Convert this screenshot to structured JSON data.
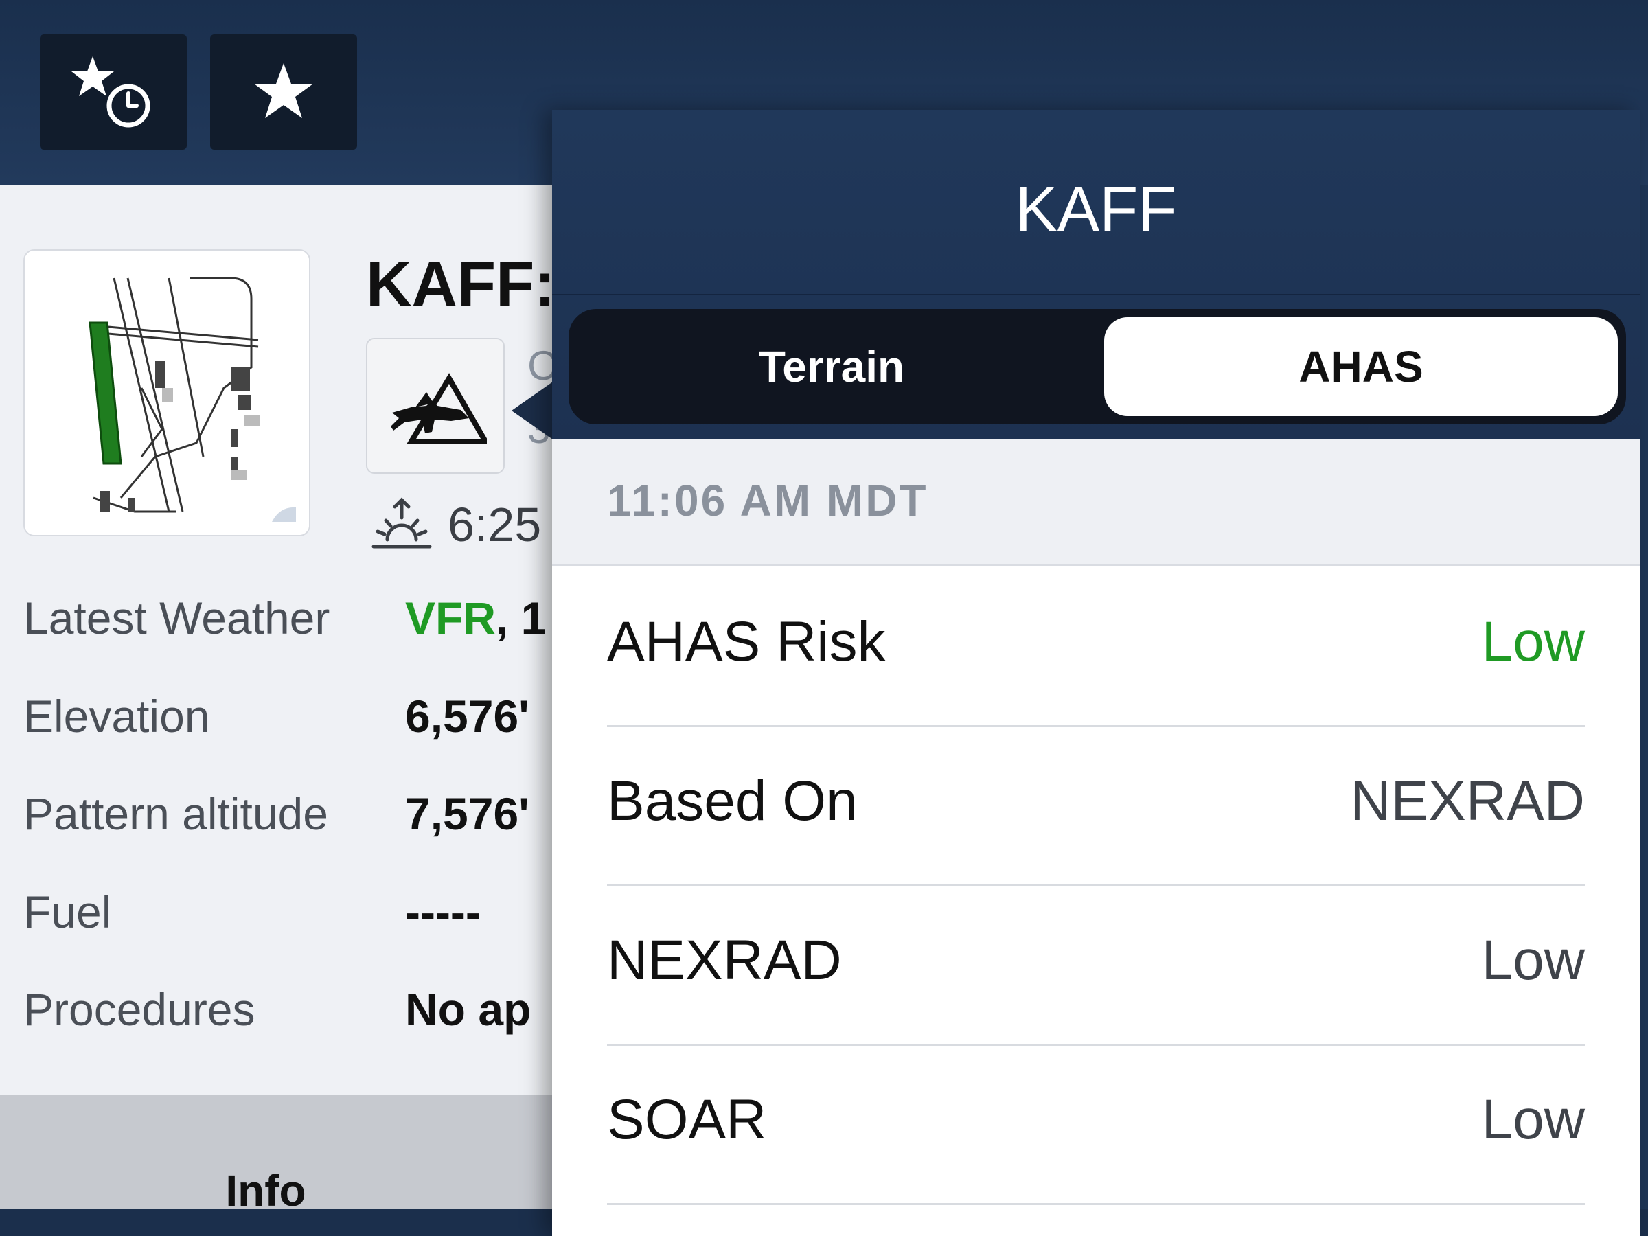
{
  "top_bar": {
    "recent_favorites_label": "Recent favorites",
    "favorites_label": "Favorites"
  },
  "airport": {
    "title": "KAFF:",
    "cut_line1": "C",
    "cut_line2": "3",
    "sunrise_time": "6:25",
    "info_rows": [
      {
        "label": "Latest Weather",
        "value_status": "VFR",
        "value_rest": ", 1"
      },
      {
        "label": "Elevation",
        "value": "6,576'"
      },
      {
        "label": "Pattern altitude",
        "value": "7,576'"
      },
      {
        "label": "Fuel",
        "value": "-----"
      },
      {
        "label": "Procedures",
        "value": "No ap"
      }
    ],
    "tab_info": "Info"
  },
  "popover": {
    "title": "KAFF",
    "segments": [
      {
        "label": "Terrain",
        "selected": false
      },
      {
        "label": "AHAS",
        "selected": true
      }
    ],
    "timestamp": "11:06 AM MDT",
    "rows": [
      {
        "label": "AHAS Risk",
        "value": "Low",
        "highlight": true
      },
      {
        "label": "Based On",
        "value": "NEXRAD",
        "highlight": false
      },
      {
        "label": "NEXRAD",
        "value": "Low",
        "highlight": false
      },
      {
        "label": "SOAR",
        "value": "Low",
        "highlight": false
      }
    ]
  },
  "colors": {
    "header_navy": "#1e3555",
    "vfr_green": "#1f9a24",
    "risk_low_green": "#1f9a24"
  }
}
